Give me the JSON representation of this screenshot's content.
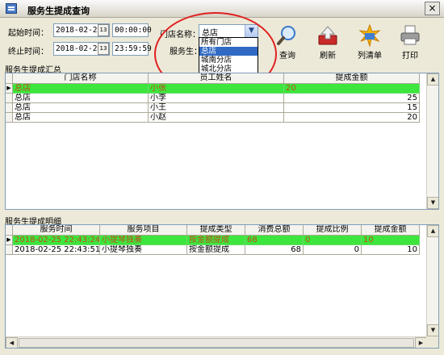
{
  "window": {
    "title": "服务生提成查询",
    "close_label": "×"
  },
  "filters": {
    "start_label": "起始时间：",
    "start_date": "2018-02-25",
    "start_time": "00:00:00",
    "end_label": "终止时间：",
    "end_date": "2018-02-25",
    "end_time": "23:59:59",
    "calendar_glyph": "13",
    "store_label": "门店名称：",
    "store_value": "总店",
    "waiter_label": "服务生：",
    "store_options": [
      "所有门店",
      "总店",
      "城南分店",
      "城北分店"
    ],
    "store_selected_index": 1
  },
  "toolbar": {
    "query_label": "查询",
    "refresh_label": "刷新",
    "list_label": "列清单",
    "print_label": "打印"
  },
  "summary": {
    "title": "服务生提成汇总",
    "columns": [
      "门店名称",
      "员工姓名",
      "提成金额"
    ],
    "rows": [
      [
        "总店",
        "小张",
        "20"
      ],
      [
        "总店",
        "小李",
        "25"
      ],
      [
        "总店",
        "小王",
        "15"
      ],
      [
        "总店",
        "小赵",
        "20"
      ]
    ]
  },
  "detail": {
    "title": "服务生提成明细",
    "columns": [
      "服务时间",
      "服务项目",
      "提成类型",
      "消费总额",
      "提成比例",
      "提成金额"
    ],
    "rows": [
      [
        "2018-02-25 22:43:24",
        "小提琴独奏",
        "按金额提成",
        "68",
        "0",
        "10"
      ],
      [
        "2018-02-25 22:43:51",
        "小提琴独奏",
        "按金额提成",
        "68",
        "0",
        "10"
      ]
    ]
  },
  "colors": {
    "selected_row_bg": "#3CE63C",
    "selected_row_text": "#C0491F",
    "annotation_circle": "#E02020"
  }
}
